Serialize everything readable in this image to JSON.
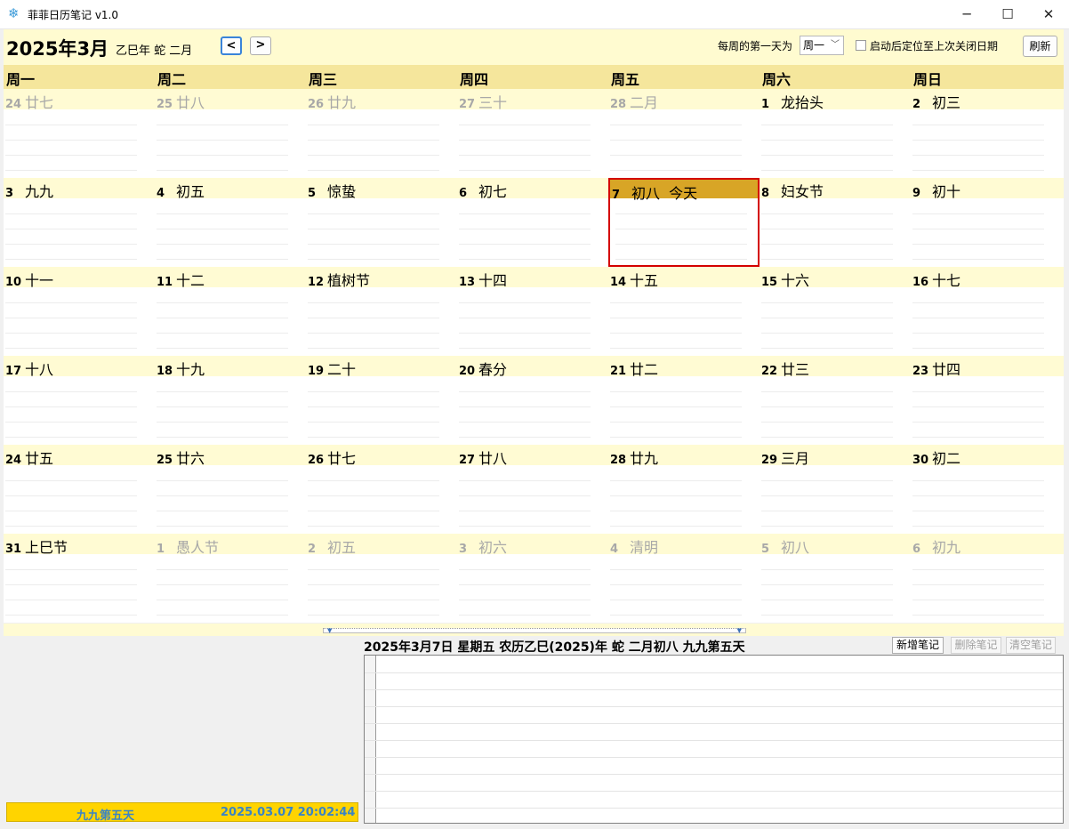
{
  "window": {
    "title": "菲菲日历笔记 v1.0",
    "app_icon": "snowflake-icon",
    "controls": {
      "minimize": "─",
      "maximize": "☐",
      "close": "✕"
    }
  },
  "header": {
    "month_title": "2025年3月",
    "lunar_year": "乙巳年 蛇 二月",
    "prev_label": "<",
    "next_label": ">",
    "week_start_label": "每周的第一天为",
    "week_start_value": "周一",
    "restore_label": "启动后定位至上次关闭日期",
    "restore_checked": false,
    "refresh_label": "刷新"
  },
  "weekdays": [
    "周一",
    "周二",
    "周三",
    "周四",
    "周五",
    "周六",
    "周日"
  ],
  "weeks": [
    [
      {
        "day": "24",
        "lunar": "廿七",
        "other": true
      },
      {
        "day": "25",
        "lunar": "廿八",
        "other": true
      },
      {
        "day": "26",
        "lunar": "廿九",
        "other": true
      },
      {
        "day": "27",
        "lunar": "三十",
        "other": true
      },
      {
        "day": "28",
        "lunar": "二月",
        "other": true
      },
      {
        "day": "1",
        "lunar": "龙抬头",
        "other": false
      },
      {
        "day": "2",
        "lunar": "初三",
        "other": false
      }
    ],
    [
      {
        "day": "3",
        "lunar": "九九",
        "other": false
      },
      {
        "day": "4",
        "lunar": "初五",
        "other": false
      },
      {
        "day": "5",
        "lunar": "惊蛰",
        "other": false
      },
      {
        "day": "6",
        "lunar": "初七",
        "other": false
      },
      {
        "day": "7",
        "lunar": "初八  今天",
        "other": false,
        "today": true
      },
      {
        "day": "8",
        "lunar": "妇女节",
        "other": false
      },
      {
        "day": "9",
        "lunar": "初十",
        "other": false
      }
    ],
    [
      {
        "day": "10",
        "lunar": "十一",
        "other": false
      },
      {
        "day": "11",
        "lunar": "十二",
        "other": false
      },
      {
        "day": "12",
        "lunar": "植树节",
        "other": false
      },
      {
        "day": "13",
        "lunar": "十四",
        "other": false
      },
      {
        "day": "14",
        "lunar": "十五",
        "other": false
      },
      {
        "day": "15",
        "lunar": "十六",
        "other": false
      },
      {
        "day": "16",
        "lunar": "十七",
        "other": false
      }
    ],
    [
      {
        "day": "17",
        "lunar": "十八",
        "other": false
      },
      {
        "day": "18",
        "lunar": "十九",
        "other": false
      },
      {
        "day": "19",
        "lunar": "二十",
        "other": false
      },
      {
        "day": "20",
        "lunar": "春分",
        "other": false
      },
      {
        "day": "21",
        "lunar": "廿二",
        "other": false
      },
      {
        "day": "22",
        "lunar": "廿三",
        "other": false
      },
      {
        "day": "23",
        "lunar": "廿四",
        "other": false
      }
    ],
    [
      {
        "day": "24",
        "lunar": "廿五",
        "other": false
      },
      {
        "day": "25",
        "lunar": "廿六",
        "other": false
      },
      {
        "day": "26",
        "lunar": "廿七",
        "other": false
      },
      {
        "day": "27",
        "lunar": "廿八",
        "other": false
      },
      {
        "day": "28",
        "lunar": "廿九",
        "other": false
      },
      {
        "day": "29",
        "lunar": "三月",
        "other": false
      },
      {
        "day": "30",
        "lunar": "初二",
        "other": false
      }
    ],
    [
      {
        "day": "31",
        "lunar": "上巳节",
        "other": false
      },
      {
        "day": "1",
        "lunar": "愚人节",
        "other": true
      },
      {
        "day": "2",
        "lunar": "初五",
        "other": true
      },
      {
        "day": "3",
        "lunar": "初六",
        "other": true
      },
      {
        "day": "4",
        "lunar": "清明",
        "other": true
      },
      {
        "day": "5",
        "lunar": "初八",
        "other": true
      },
      {
        "day": "6",
        "lunar": "初九",
        "other": true
      }
    ]
  ],
  "notes_panel": {
    "date_info": "2025年3月7日 星期五 农历乙巳(2025)年 蛇 二月初八 九九第五天",
    "add_label": "新增笔记",
    "delete_label": "删除笔记",
    "clear_label": "清空笔记"
  },
  "status": {
    "nine_nine": "九九第五天",
    "clock": "2025.03.07 20:02:44"
  },
  "colors": {
    "header_bg": "#fffbd0",
    "weekday_bg": "#f5e69c",
    "today_bg": "#d8a526",
    "today_border": "#d40000",
    "status_bg": "#ffd400",
    "status_text": "#3a84c4"
  }
}
